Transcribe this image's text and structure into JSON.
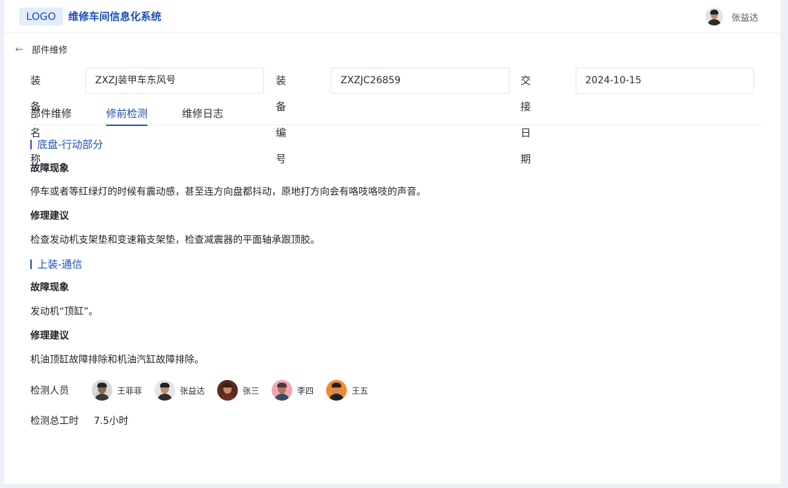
{
  "header": {
    "logo": "LOGO",
    "title": "维修车间信息化系统",
    "user_name": "张益达"
  },
  "breadcrumb": {
    "label": "部件维修"
  },
  "info": {
    "equip_name_label": "装备名称",
    "equip_name": "ZXZJ装甲车东风号",
    "equip_no_label": "装备编号",
    "equip_no": "ZXZJC26859",
    "date_label": "交接日期",
    "date": "2024-10-15"
  },
  "tabs": [
    {
      "label": "部件维修",
      "active": false
    },
    {
      "label": "修前检测",
      "active": true
    },
    {
      "label": "维修日志",
      "active": false
    }
  ],
  "sections": [
    {
      "title": "底盘-行动部分",
      "fault_label": "故障现象",
      "fault_text": "停车或者等红绿灯的时候有震动感，甚至连方向盘都抖动，原地打方向会有咯吱咯吱的声音。",
      "advice_label": "修理建议",
      "advice_text": "检查发动机支架垫和变速箱支架垫，检查减震器的平面轴承跟顶胶。"
    },
    {
      "title": "上装-通信",
      "fault_label": "故障现象",
      "fault_text": "发动机“顶缸”。",
      "advice_label": "修理建议",
      "advice_text": "机油顶缸故障排除和机油汽缸故障排除。"
    }
  ],
  "inspectors": {
    "label": "检测人员",
    "people": [
      {
        "name": "王菲菲",
        "bg": "#d8d8d8",
        "skin": "#8a6a55",
        "hair": "#2b2420",
        "shirt": "#3a3a3a"
      },
      {
        "name": "张益达",
        "bg": "#e6e6e6",
        "skin": "#b98d6f",
        "hair": "#222222",
        "shirt": "#2c2c2c"
      },
      {
        "name": "张三",
        "bg": "#5a2a1e",
        "skin": "#c58d6a",
        "hair": "#3b2217",
        "shirt": "#6b2f22"
      },
      {
        "name": "李四",
        "bg": "#f0a7b3",
        "skin": "#a97a5e",
        "hair": "#4a3b33",
        "shirt": "#3c4a63"
      },
      {
        "name": "王五",
        "bg": "#f08a2c",
        "skin": "#c98e63",
        "hair": "#2a1d14",
        "shirt": "#202020"
      }
    ]
  },
  "hours": {
    "label": "检测总工时",
    "value": "7.5小时"
  },
  "colors": {
    "accent": "#1f4fb4",
    "page_bg": "#eef0f7"
  }
}
